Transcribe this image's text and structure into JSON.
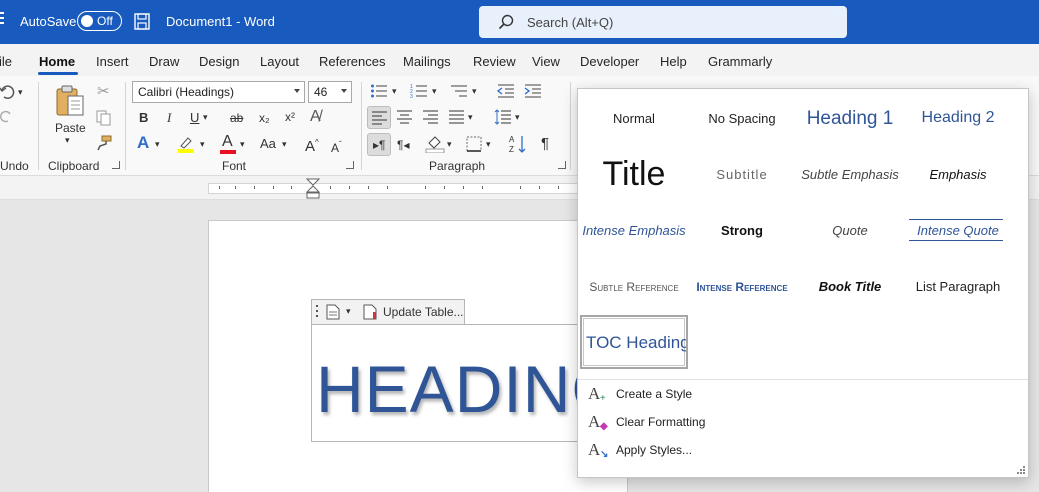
{
  "colors": {
    "accent": "#185abd",
    "heading": "#2f5597",
    "font_color_bar": "#e81123",
    "highlight_bar": "#ffff00"
  },
  "titlebar": {
    "autosave_label": "AutoSave",
    "autosave_state": "Off",
    "document_name": "Document1  -  Word",
    "search_placeholder": "Search (Alt+Q)",
    "left_edge_text": "ile"
  },
  "tabs": [
    "Home",
    "Insert",
    "Draw",
    "Design",
    "Layout",
    "References",
    "Mailings",
    "Review",
    "View",
    "Developer",
    "Help",
    "Grammarly"
  ],
  "active_tab": "Home",
  "ribbon": {
    "undo_label": "Undo",
    "clipboard": {
      "label": "Clipboard",
      "paste_label": "Paste"
    },
    "font": {
      "label": "Font",
      "font_name": "Calibri (Headings)",
      "font_size": "46",
      "bold": "B",
      "italic": "I",
      "underline": "U",
      "strikethrough": "ab",
      "subscript": "x₂",
      "superscript": "x²",
      "text_effects": "A",
      "font_color": "A",
      "change_case": "Aa",
      "grow": "A",
      "shrink": "A"
    },
    "paragraph": {
      "label": "Paragraph",
      "pilcrow": "¶"
    }
  },
  "document": {
    "toc_update_label": "Update Table...",
    "heading_text": "HEADING"
  },
  "styles_gallery": {
    "items": [
      {
        "label": "Normal"
      },
      {
        "label": "No Spacing"
      },
      {
        "label": "Heading 1"
      },
      {
        "label": "Heading 2"
      },
      {
        "label": "Title"
      },
      {
        "label": "Subtitle"
      },
      {
        "label": "Subtle Emphasis"
      },
      {
        "label": "Emphasis"
      },
      {
        "label": "Intense Emphasis"
      },
      {
        "label": "Strong"
      },
      {
        "label": "Quote"
      },
      {
        "label": "Intense Quote"
      },
      {
        "label": "Subtle Reference"
      },
      {
        "label": "Intense Reference"
      },
      {
        "label": "Book Title"
      },
      {
        "label": "List Paragraph"
      },
      {
        "label": "TOC Heading"
      }
    ],
    "selected": "TOC Heading",
    "actions": [
      {
        "label": "Create a Style",
        "icon": "create-style-icon"
      },
      {
        "label": "Clear Formatting",
        "icon": "clear-formatting-icon"
      },
      {
        "label": "Apply Styles...",
        "icon": "apply-styles-icon"
      }
    ]
  }
}
